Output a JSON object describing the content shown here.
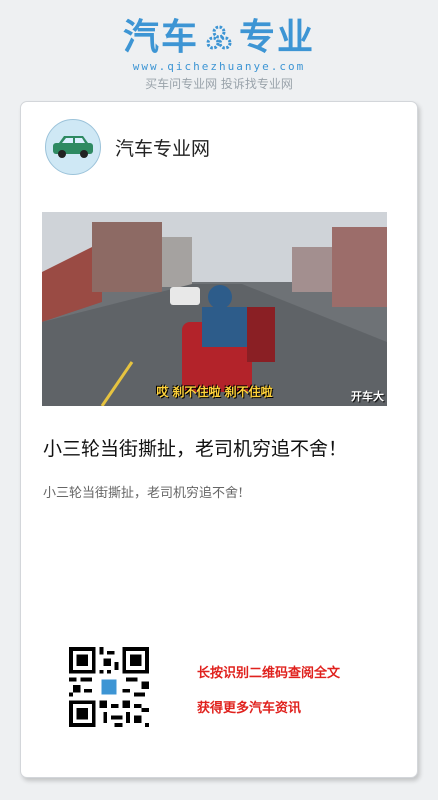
{
  "brand": {
    "name_left": "汽车",
    "name_right": "专业",
    "url": "www.qichezhuanye.com",
    "slogan": "买车问专业网 投诉找专业网"
  },
  "author": {
    "name": "汽车专业网"
  },
  "video": {
    "subtitle": "哎 刹不住啦 刹不住啦",
    "watermark": "开车大"
  },
  "article": {
    "title": "小三轮当街撕扯，老司机穷追不舍！",
    "summary": "小三轮当街撕扯，老司机穷追不舍!"
  },
  "cta": {
    "line1": "长按识别二维码查阅全文",
    "line2": "获得更多汽车资讯"
  },
  "colors": {
    "brand": "#3d95d4",
    "cta": "#e0221e"
  }
}
